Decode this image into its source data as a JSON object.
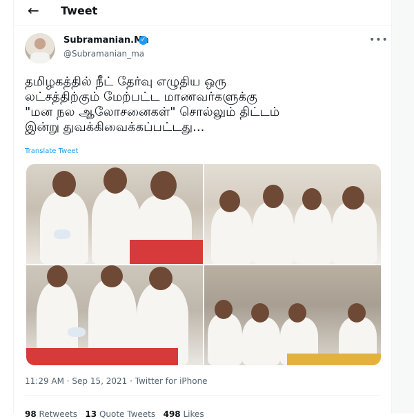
{
  "header": {
    "back_glyph": "←",
    "title": "Tweet"
  },
  "tweet": {
    "author_name": "Subramanian.Ma",
    "verified_glyph": "✓",
    "author_handle": "@Subramanian_ma",
    "more_glyph": "•••",
    "text_lines": [
      "தமிழகத்தில் நீட் தேர்வு எழுதிய ஒரு",
      "லட்சத்திற்கும் மேற்பட்ட மாணவர்களுக்கு",
      "\"மன நல ஆலோசனைகள்\" சொல்லும் திட்டம்",
      "இன்று துவக்கிவைக்கப்பட்டது..."
    ],
    "translate_label": "Translate Tweet",
    "timestamp": "11:29 AM · Sep 15, 2021 · Twitter for iPhone",
    "stats": {
      "retweets": "98",
      "retweets_label": "Retweets",
      "quotes": "13",
      "quotes_label": "Quote Tweets",
      "likes": "498",
      "likes_label": "Likes"
    }
  },
  "icons": {
    "back": "arrow-left-icon",
    "verified": "verified-badge-icon",
    "more": "more-horizontal-icon"
  },
  "colors": {
    "accent": "#1d9bf0",
    "text": "#0f1419",
    "muted": "#536471",
    "divider": "#eff3f4"
  }
}
